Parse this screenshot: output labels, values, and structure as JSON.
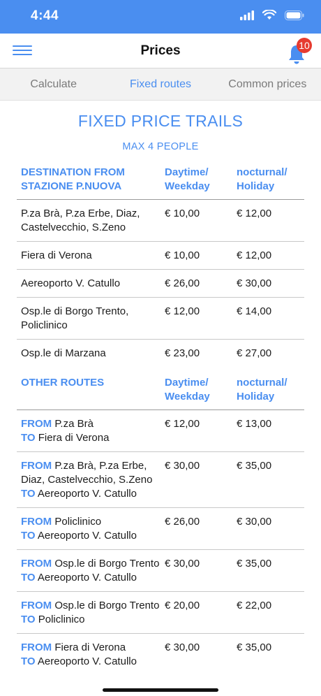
{
  "status": {
    "time": "4:44"
  },
  "nav": {
    "title": "Prices",
    "badge": "10"
  },
  "tabs": [
    {
      "label": "Calculate",
      "active": false
    },
    {
      "label": "Fixed routes",
      "active": true
    },
    {
      "label": "Common prices",
      "active": false
    }
  ],
  "main": {
    "title": "FIXED PRICE TRAILS",
    "subtitle": "MAX 4 PEOPLE",
    "table1": {
      "headers": [
        "DESTINATION FROM STAZIONE P.NUOVA",
        "Daytime/ Weekday",
        "nocturnal/ Holiday"
      ],
      "rows": [
        {
          "dest": "P.za Brà, P.za Erbe, Diaz, Castelvecchio, S.Zeno",
          "day": "€ 10,00",
          "night": "€ 12,00"
        },
        {
          "dest": "Fiera di Verona",
          "day": "€ 10,00",
          "night": "€ 12,00"
        },
        {
          "dest": "Aereoporto V. Catullo",
          "day": "€ 26,00",
          "night": "€ 30,00"
        },
        {
          "dest": "Osp.le di Borgo Trento, Policlinico",
          "day": "€ 12,00",
          "night": "€ 14,00"
        },
        {
          "dest": "Osp.le di Marzana",
          "day": "€ 23,00",
          "night": "€ 27,00"
        }
      ]
    },
    "table2": {
      "headers": [
        "OTHER ROUTES",
        "Daytime/ Weekday",
        "nocturnal/ Holiday"
      ],
      "from_label": "FROM",
      "to_label": "TO",
      "rows": [
        {
          "from": "P.za Brà",
          "to": "Fiera di Verona",
          "day": "€ 12,00",
          "night": "€ 13,00"
        },
        {
          "from": "P.za Brà, P.za Erbe, Diaz, Castelvecchio, S.Zeno",
          "to": "Aereoporto V. Catullo",
          "day": "€ 30,00",
          "night": "€ 35,00"
        },
        {
          "from": "Policlinico",
          "to": "Aereoporto V. Catullo",
          "day": "€ 26,00",
          "night": "€ 30,00"
        },
        {
          "from": "Osp.le di Borgo Trento",
          "to": "Aereoporto V. Catullo",
          "day": "€ 30,00",
          "night": "€ 35,00"
        },
        {
          "from": "Osp.le di Borgo Trento",
          "to": "Policlinico",
          "day": "€ 20,00",
          "night": "€ 22,00"
        },
        {
          "from": "Fiera di Verona",
          "to": "Aereoporto V. Catullo",
          "day": "€ 30,00",
          "night": "€ 35,00"
        }
      ]
    }
  },
  "colors": {
    "accent": "#4a8ef0",
    "badge": "#e63b30"
  }
}
